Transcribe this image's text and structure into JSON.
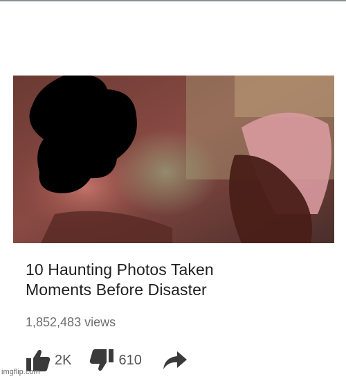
{
  "video": {
    "title_line1": "10 Haunting Photos Taken",
    "title_line2": "Moments Before Disaster",
    "views": "1,852,483 views",
    "likes": "2K",
    "dislikes": "610"
  },
  "icons": {
    "like": "thumbs-up-icon",
    "dislike": "thumbs-down-icon",
    "share": "share-arrow-icon"
  },
  "watermark": "imgflip.com",
  "colors": {
    "title": "#1f1f1f",
    "views": "#6f6f6f",
    "icon": "#3a3a3a",
    "scribble": "#000000"
  }
}
